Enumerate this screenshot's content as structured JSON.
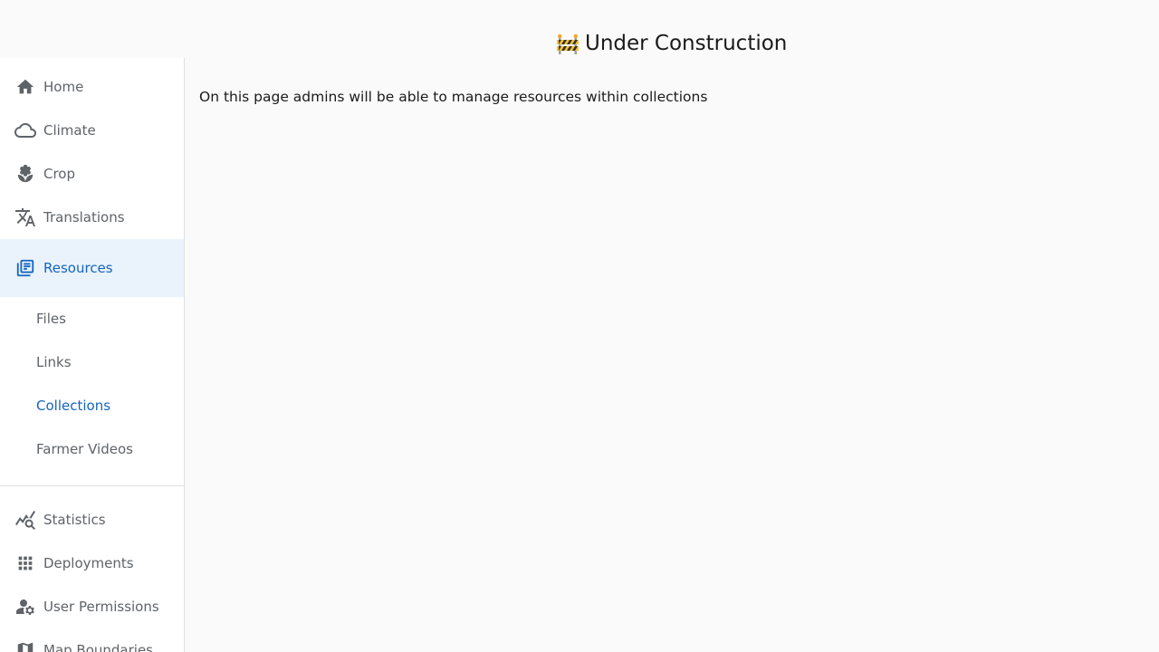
{
  "header": {
    "title": "Under Construction",
    "title_icon": "construction-barrier-icon"
  },
  "sidebar": {
    "items": [
      {
        "label": "Home",
        "icon": "home-icon"
      },
      {
        "label": "Climate",
        "icon": "cloud-icon"
      },
      {
        "label": "Crop",
        "icon": "seedling-icon"
      },
      {
        "label": "Translations",
        "icon": "translate-icon"
      },
      {
        "label": "Resources",
        "icon": "library-books-icon",
        "active": true
      },
      {
        "label": "Statistics",
        "icon": "query-stats-icon"
      },
      {
        "label": "Deployments",
        "icon": "apps-grid-icon"
      },
      {
        "label": "User Permissions",
        "icon": "manage-accounts-icon"
      },
      {
        "label": "Map Boundaries",
        "icon": "map-icon"
      }
    ],
    "sub_items": [
      {
        "label": "Files"
      },
      {
        "label": "Links"
      },
      {
        "label": "Collections",
        "active": true
      },
      {
        "label": "Farmer Videos"
      }
    ]
  },
  "main": {
    "message": "On this page admins will be able to manage resources within collections"
  },
  "colors": {
    "accent": "#1565c0",
    "active_bg": "#eaf3fb",
    "icon_gray": "#5f6368"
  }
}
